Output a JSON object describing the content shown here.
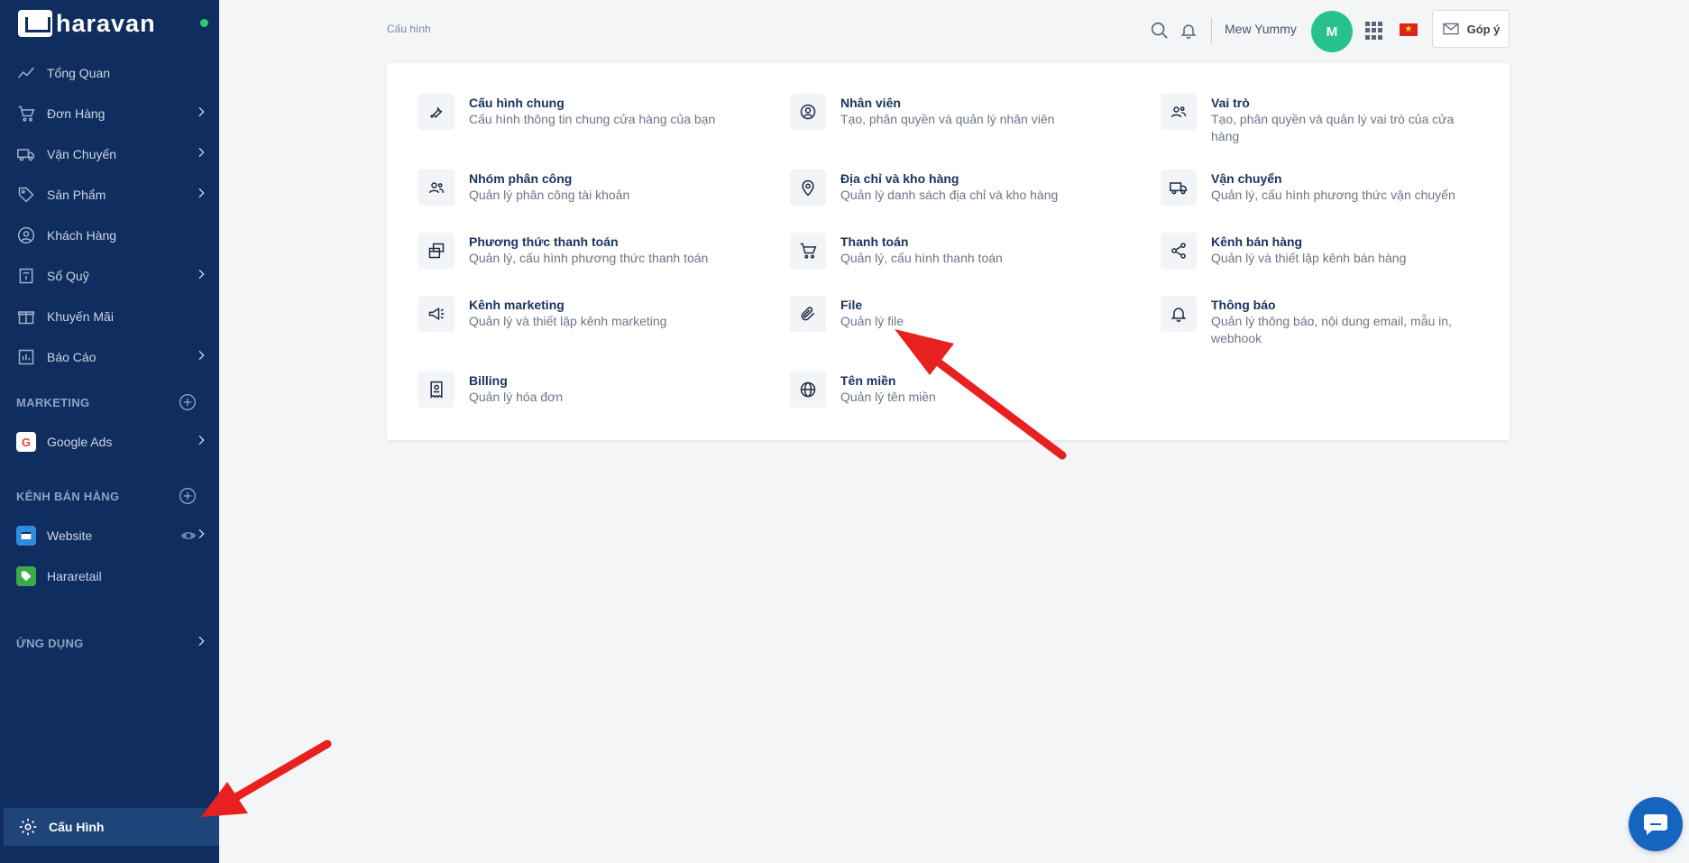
{
  "brand": {
    "logo_text": "haravan"
  },
  "sidebar": {
    "items": [
      {
        "label": "Tổng Quan",
        "icon": "trend-icon"
      },
      {
        "label": "Đơn Hàng",
        "icon": "cart-icon"
      },
      {
        "label": "Vận Chuyển",
        "icon": "truck-icon"
      },
      {
        "label": "Sản Phẩm",
        "icon": "tag-icon"
      },
      {
        "label": "Khách Hàng",
        "icon": "user-circle-icon"
      },
      {
        "label": "Sổ Quỹ",
        "icon": "ledger-icon"
      },
      {
        "label": "Khuyến Mãi",
        "icon": "gift-icon"
      },
      {
        "label": "Báo Cáo",
        "icon": "chart-icon"
      }
    ],
    "marketing_title": "MARKETING",
    "marketing_items": [
      {
        "label": "Google Ads",
        "icon_text": "G"
      }
    ],
    "sales_title": "KÊNH BÁN HÀNG",
    "sales_items": [
      {
        "label": "Website"
      },
      {
        "label": "Hararetail"
      }
    ],
    "apps_title": "ỨNG DỤNG",
    "settings_label": "Cấu Hình"
  },
  "breadcrumb": "Cấu hình",
  "topbar": {
    "username": "Mew Yummy",
    "avatar_initial": "M",
    "feedback_label": "Góp ý",
    "accent": "#27c28c"
  },
  "settings": [
    {
      "title": "Cấu hình chung",
      "desc": "Cấu hình thông tin chung cửa hàng của bạn",
      "icon": "wrench-icon"
    },
    {
      "title": "Nhân viên",
      "desc": "Tạo, phân quyền và quản lý nhân viên",
      "icon": "user-circle-icon"
    },
    {
      "title": "Vai trò",
      "desc": "Tạo, phân quyền và quản lý vai trò của cửa hàng",
      "icon": "users-icon"
    },
    {
      "title": "Nhóm phân công",
      "desc": "Quản lý phân công tài khoản",
      "icon": "group-icon"
    },
    {
      "title": "Địa chỉ và kho hàng",
      "desc": "Quản lý danh sách địa chỉ và kho hàng",
      "icon": "location-pin-icon"
    },
    {
      "title": "Vận chuyển",
      "desc": "Quản lý, cấu hình phương thức vận chuyển",
      "icon": "truck-icon"
    },
    {
      "title": "Phương thức thanh toán",
      "desc": "Quản lý, cấu hình phương thức thanh toán",
      "icon": "cards-icon"
    },
    {
      "title": "Thanh toán",
      "desc": "Quản lý, cấu hình thanh toán",
      "icon": "cart-icon"
    },
    {
      "title": "Kênh bán hàng",
      "desc": "Quản lý và thiết lập kênh bán hàng",
      "icon": "share-icon"
    },
    {
      "title": "Kênh marketing",
      "desc": "Quản lý và thiết lập kênh marketing",
      "icon": "megaphone-icon"
    },
    {
      "title": "File",
      "desc": "Quản lý file",
      "icon": "paperclip-icon"
    },
    {
      "title": "Thông báo",
      "desc": "Quản lý thông báo, nội dung email, mẫu in, webhook",
      "icon": "bell-icon"
    },
    {
      "title": "Billing",
      "desc": "Quản lý hóa đơn",
      "icon": "receipt-icon"
    },
    {
      "title": "Tên miền",
      "desc": "Quản lý tên miền",
      "icon": "globe-icon"
    }
  ]
}
